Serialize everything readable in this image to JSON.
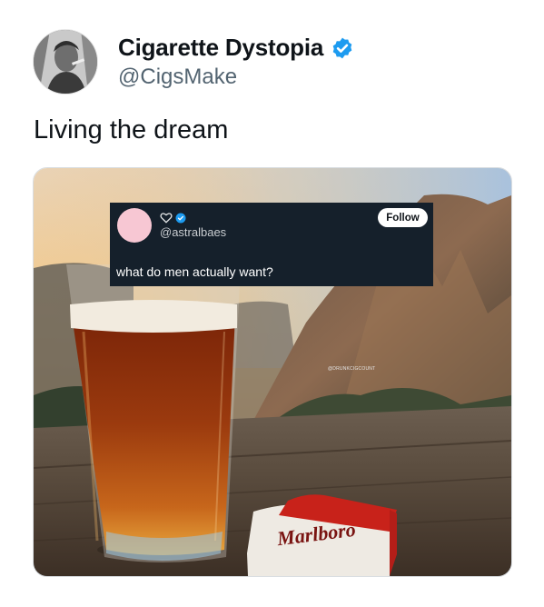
{
  "tweet": {
    "display_name": "Cigarette Dystopia",
    "handle": "@CigsMake",
    "text": "Living the dream",
    "verified": true
  },
  "embedded_post": {
    "handle": "@astralbaes",
    "follow_label": "Follow",
    "text": "what do men actually want?"
  },
  "photo": {
    "watermark": "@DRUNKCIGCOUNT",
    "brand": "Marlboro"
  },
  "colors": {
    "verified_blue": "#1d9bf0",
    "embedded_bg": "#15202b"
  },
  "icons": {
    "verified": "verified-badge-icon",
    "heart": "heart-outline-icon"
  }
}
